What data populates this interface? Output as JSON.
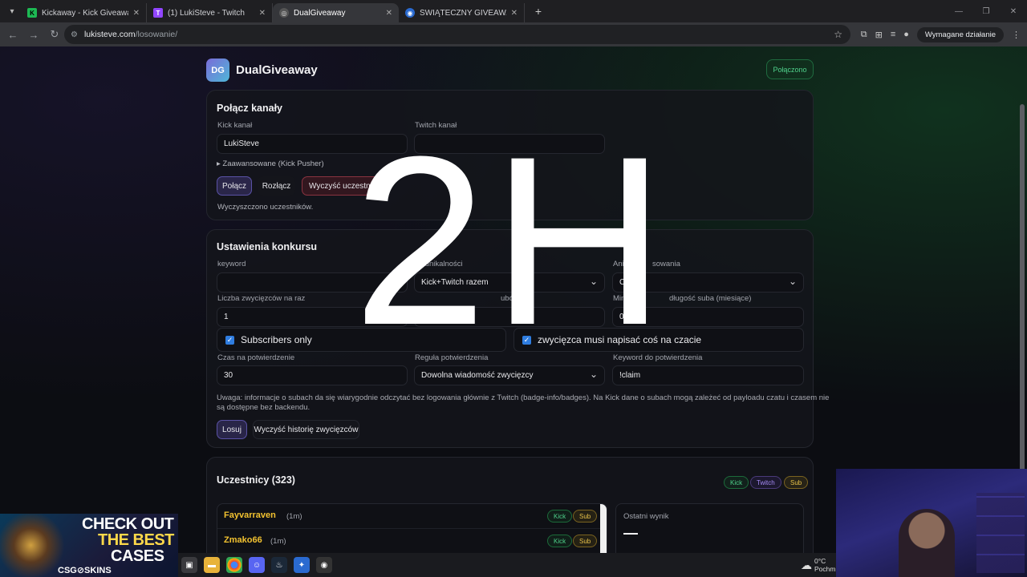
{
  "browser": {
    "tabs": [
      {
        "title": "Kickaway - Kick Giveaway Tool"
      },
      {
        "title": "(1) LukiSteve - Twitch"
      },
      {
        "title": "DualGiveaway"
      },
      {
        "title": "ŚWIĄTECZNY GIVEAWAY"
      }
    ],
    "url_host": "lukisteve.com",
    "url_path": "/losowanie/",
    "action_needed": "Wymagane działanie"
  },
  "app": {
    "logo_initials": "DG",
    "name": "DualGiveaway",
    "status": "Połączono"
  },
  "connect": {
    "title": "Połącz kanały",
    "kick_label": "Kick kanał",
    "kick_value": "LukiSteve",
    "twitch_label": "Twitch kanał",
    "advanced": "▸ Zaawansowane (Kick Pusher)",
    "btn_connect": "Połącz",
    "btn_disconnect": "Rozłącz",
    "btn_clear": "Wyczyść uczestn",
    "message": "Wyczyszczono uczestników."
  },
  "settings": {
    "title": "Ustawienia konkursu",
    "keyword_label": "keyword",
    "keyword_value": "",
    "uniqueness_label": "yb unikalności",
    "uniqueness_value": "Kick+Twitch razem",
    "animation_label": "Anim",
    "animation_label_2": "sowania",
    "animation_value": "C",
    "winners_label": "Liczba zwycięzców na raz",
    "winners_value": "1",
    "subs_label": "ubów",
    "subs_value": "",
    "minsub_label_a": "Mini",
    "minsub_label_b": "długość suba (miesiące)",
    "minsub_value": "0",
    "subscribers_only": "Subscribers only",
    "must_write": "zwycięzca musi napisać coś na czacie",
    "confirm_time_label": "Czas na potwierdzenie",
    "confirm_time_value": "30",
    "confirm_rule_label": "Reguła potwierdzenia",
    "confirm_rule_value": "Dowolna wiadomość zwycięzcy",
    "confirm_keyword_label": "Keyword do potwierdzenia",
    "confirm_keyword_value": "!claim",
    "note_line1": "Uwaga: informacje o subach da się wiarygodnie odczytać bez logowania głównie z Twitch (badge-info/badges). Na Kick dane o subach mogą zależeć od payloadu czatu i czasem nie",
    "note_line2": "są dostępne bez backendu.",
    "btn_draw": "Losuj",
    "btn_clear_history": "Wyczyść historię zwycięzców"
  },
  "participants": {
    "title": "Uczestnicy (323)",
    "filter_kick": "Kick",
    "filter_twitch": "Twitch",
    "filter_sub": "Sub",
    "rows": [
      {
        "name": "Fayvarraven",
        "time": "(1m)",
        "platform": "Kick",
        "sub": "Sub"
      },
      {
        "name": "Zmako66",
        "time": "(1m)",
        "platform": "Kick",
        "sub": "Sub"
      }
    ],
    "result_label": "Ostatni wynik",
    "result_value": "—"
  },
  "overlay": {
    "big_text": "2H"
  },
  "ad": {
    "line1": "CHECK OUT",
    "line2": "THE BEST",
    "line3": "CASES",
    "brand": "CSG⊘SKINS"
  },
  "weather": {
    "temp": "0°C",
    "desc": "Pochm"
  }
}
